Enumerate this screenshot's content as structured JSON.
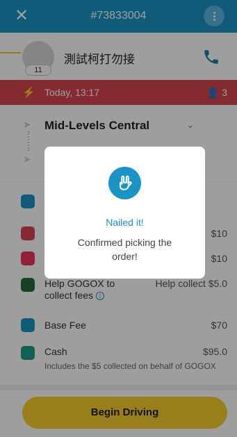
{
  "header": {
    "order_id": "#73833004",
    "close_icon": "close-icon",
    "more_icon": "more-vertical-icon"
  },
  "contact": {
    "name": "測試柯打勿接",
    "avatar_badge": "11",
    "phone_icon": "phone-icon"
  },
  "schedule": {
    "time": "Today, 13:17",
    "passenger_count": "3",
    "bolt_icon": "bolt-icon"
  },
  "route": {
    "pickup": "Mid-Levels Central"
  },
  "items": [
    {
      "label": "",
      "value": "",
      "icon": "smile-icon",
      "color": "#1b93c6"
    },
    {
      "label": "",
      "value": "$10",
      "icon": "hand-icon",
      "color": "#d9454f"
    },
    {
      "label": "",
      "value": "$10",
      "icon": "paw-icon",
      "color": "#e8365d"
    },
    {
      "label": "Help GOGOX to collect fees",
      "value": "Help collect $5.0",
      "icon": "x-logo-icon",
      "color": "#2a6a3a"
    },
    {
      "label": "Base Fee",
      "value": "$70",
      "icon": "truck-icon",
      "color": "#1b93c6"
    },
    {
      "label": "Cash",
      "value": "$95.0",
      "sub": "Includes the $5 collected on behalf of GOGOX",
      "icon": "cash-icon",
      "color": "#1c9a8c"
    }
  ],
  "actions": {
    "begin_driving": "Begin Driving"
  },
  "dialog": {
    "title": "Nailed it!",
    "message": "Confirmed picking the order!",
    "icon": "rock-hand-icon"
  },
  "colors": {
    "brand_blue": "#1b93c6",
    "alert_red": "#d9454f",
    "accent_yellow": "#f5cd2c"
  }
}
